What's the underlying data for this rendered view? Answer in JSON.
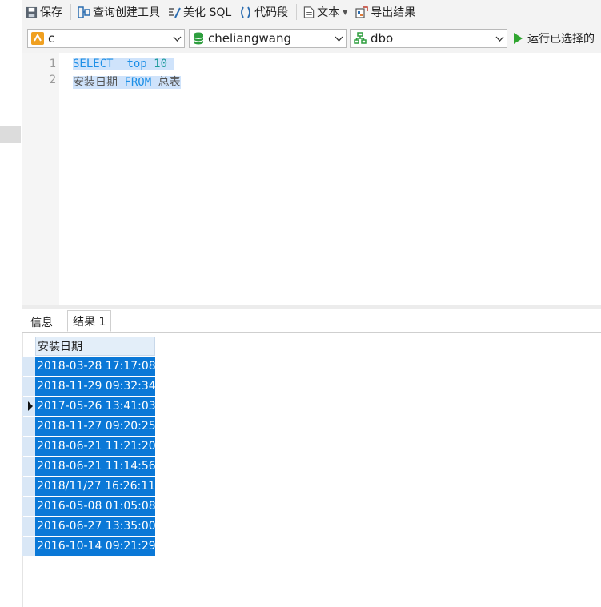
{
  "toolbar": {
    "save": "保存",
    "query_builder": "查询创建工具",
    "beautify": "美化 SQL",
    "snippets": "代码段",
    "text": "文本",
    "export": "导出结果"
  },
  "selectors": {
    "connection": "c",
    "database": "cheliangwang",
    "schema": "dbo"
  },
  "run": {
    "label": "运行已选择的"
  },
  "editor": {
    "line_numbers": [
      "1",
      "2"
    ],
    "line1": {
      "kw1": "SELECT",
      "kw2": "top",
      "num": "10"
    },
    "line2": {
      "col": "安装日期",
      "kw": "FROM",
      "table": "总表"
    }
  },
  "tabs": {
    "info": "信息",
    "result": "结果 1"
  },
  "grid": {
    "header": "安装日期",
    "rows": [
      "2018-03-28 17:17:08",
      "2018-11-29 09:32:34",
      "2017-05-26 13:41:03",
      "2018-11-27 09:20:25",
      "2018-06-21 11:21:20",
      "2018-06-21 11:14:56",
      "2018/11/27 16:26:11",
      "2016-05-08 01:05:08",
      "2016-06-27 13:35:00",
      "2016-10-14 09:21:29"
    ]
  },
  "colors": {
    "selection": "#0a78d7",
    "keyword": "#1d8fe6",
    "run": "#2fa52f"
  }
}
